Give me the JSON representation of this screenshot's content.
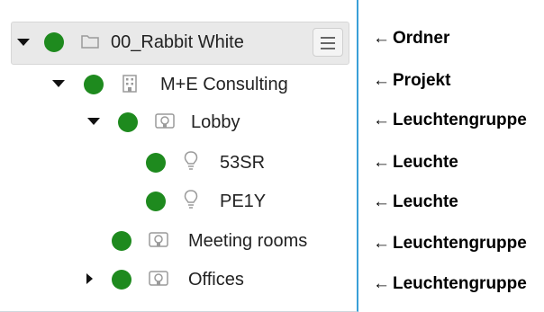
{
  "tree": {
    "items": [
      {
        "label": "00_Rabbit White",
        "type": "folder",
        "expanded": true,
        "status": "green",
        "selected": true,
        "menu_icon": "hamburger-menu-icon"
      },
      {
        "label": "M+E Consulting",
        "type": "project",
        "expanded": true,
        "status": "green"
      },
      {
        "label": "Lobby",
        "type": "luminaire-group",
        "expanded": true,
        "status": "green"
      },
      {
        "label": "53SR",
        "type": "luminaire",
        "status": "green"
      },
      {
        "label": "PE1Y",
        "type": "luminaire",
        "status": "green"
      },
      {
        "label": "Meeting rooms",
        "type": "luminaire-group",
        "status": "green"
      },
      {
        "label": "Offices",
        "type": "luminaire-group",
        "expanded": false,
        "status": "green"
      }
    ]
  },
  "annotations": {
    "arrow": "←",
    "items": [
      "Ordner",
      "Projekt",
      "Leuchtengruppe",
      "Leuchte",
      "Leuchte",
      "Leuchtengruppe",
      "Leuchtengruppe"
    ]
  },
  "colors": {
    "status_green": "#1e8a1e",
    "accent_border": "#3aa0d8",
    "selection_bg": "#e9e9e9"
  }
}
